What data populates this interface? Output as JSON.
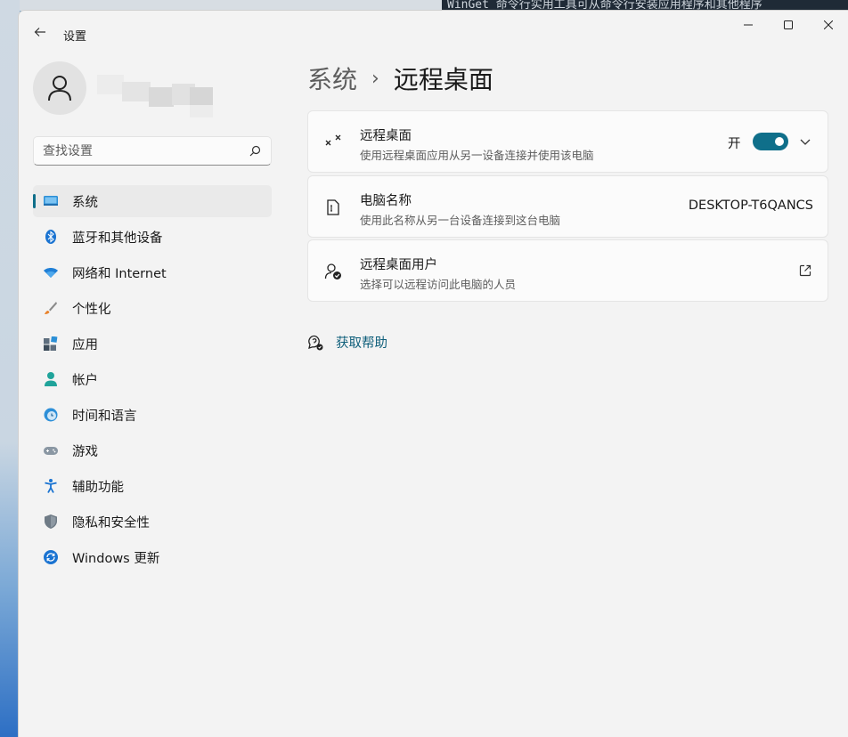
{
  "background": {
    "terminal_text": "WinGet 命令行实用工具可从命令行安装应用程序和其他程序"
  },
  "window": {
    "title": "设置"
  },
  "search": {
    "placeholder": "查找设置"
  },
  "sidebar": {
    "items": [
      {
        "label": "系统",
        "icon": "system-display-icon",
        "active": true
      },
      {
        "label": "蓝牙和其他设备",
        "icon": "bluetooth-icon",
        "active": false
      },
      {
        "label": "网络和 Internet",
        "icon": "wifi-icon",
        "active": false
      },
      {
        "label": "个性化",
        "icon": "brush-icon",
        "active": false
      },
      {
        "label": "应用",
        "icon": "apps-icon",
        "active": false
      },
      {
        "label": "帐户",
        "icon": "account-icon",
        "active": false
      },
      {
        "label": "时间和语言",
        "icon": "time-language-icon",
        "active": false
      },
      {
        "label": "游戏",
        "icon": "gamepad-icon",
        "active": false
      },
      {
        "label": "辅助功能",
        "icon": "accessibility-icon",
        "active": false
      },
      {
        "label": "隐私和安全性",
        "icon": "shield-icon",
        "active": false
      },
      {
        "label": "Windows 更新",
        "icon": "windows-update-icon",
        "active": false
      }
    ]
  },
  "breadcrumb": {
    "parent": "系统",
    "separator": "›",
    "current": "远程桌面"
  },
  "cards": {
    "remote_desktop": {
      "title": "远程桌面",
      "description": "使用远程桌面应用从另一设备连接并使用该电脑",
      "toggle_label": "开",
      "toggle_on": true
    },
    "pc_name": {
      "title": "电脑名称",
      "description": "使用此名称从另一台设备连接到这台电脑",
      "value": "DESKTOP-T6QANCS"
    },
    "remote_users": {
      "title": "远程桌面用户",
      "description": "选择可以远程访问此电脑的人员"
    }
  },
  "help": {
    "label": "获取帮助"
  },
  "colors": {
    "accent": "#0f6f8a",
    "window_bg": "#f3f3f3",
    "card_bg": "#fbfbfb"
  }
}
